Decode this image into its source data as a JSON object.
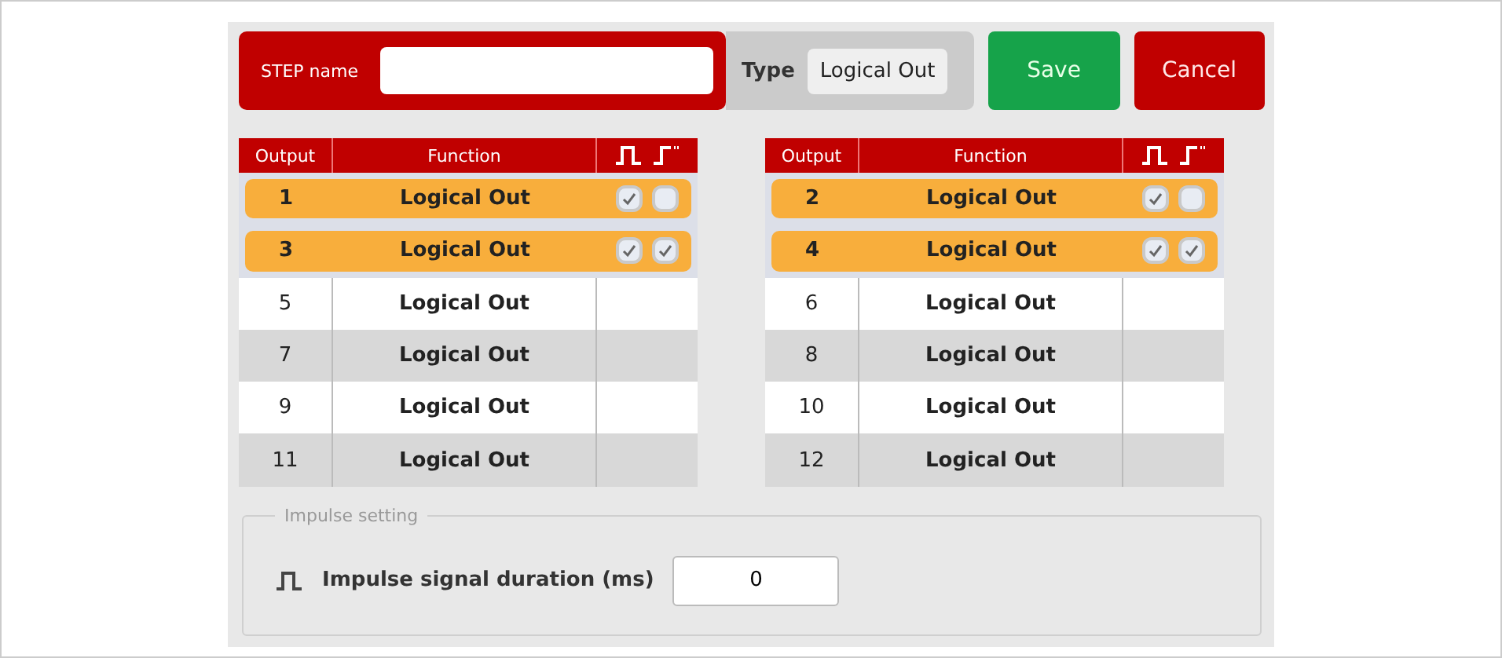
{
  "step_name": {
    "label": "STEP name"
  },
  "type": {
    "label": "Type",
    "value": "Logical Out"
  },
  "buttons": [
    {
      "kind": "save",
      "label": "Save"
    },
    {
      "kind": "cancel",
      "label": "Cancel"
    }
  ],
  "tables": [
    {
      "columns": [
        "Output",
        "Function"
      ],
      "rows": [
        {
          "output": "1",
          "function": "Logical Out",
          "selected": true,
          "impulse": true,
          "edge": false
        },
        {
          "output": "3",
          "function": "Logical Out",
          "selected": true,
          "impulse": true,
          "edge": true
        },
        {
          "output": "5",
          "function": "Logical Out",
          "selected": false
        },
        {
          "output": "7",
          "function": "Logical Out",
          "selected": false
        },
        {
          "output": "9",
          "function": "Logical Out",
          "selected": false
        },
        {
          "output": "11",
          "function": "Logical Out",
          "selected": false
        }
      ]
    },
    {
      "columns": [
        "Output",
        "Function"
      ],
      "rows": [
        {
          "output": "2",
          "function": "Logical Out",
          "selected": true,
          "impulse": true,
          "edge": false
        },
        {
          "output": "4",
          "function": "Logical Out",
          "selected": true,
          "impulse": true,
          "edge": true
        },
        {
          "output": "6",
          "function": "Logical Out",
          "selected": false
        },
        {
          "output": "8",
          "function": "Logical Out",
          "selected": false
        },
        {
          "output": "10",
          "function": "Logical Out",
          "selected": false
        },
        {
          "output": "12",
          "function": "Logical Out",
          "selected": false
        }
      ]
    }
  ],
  "impulse_setting": {
    "legend": "Impulse setting",
    "label": "Impulse signal duration (ms)",
    "value": "0"
  }
}
